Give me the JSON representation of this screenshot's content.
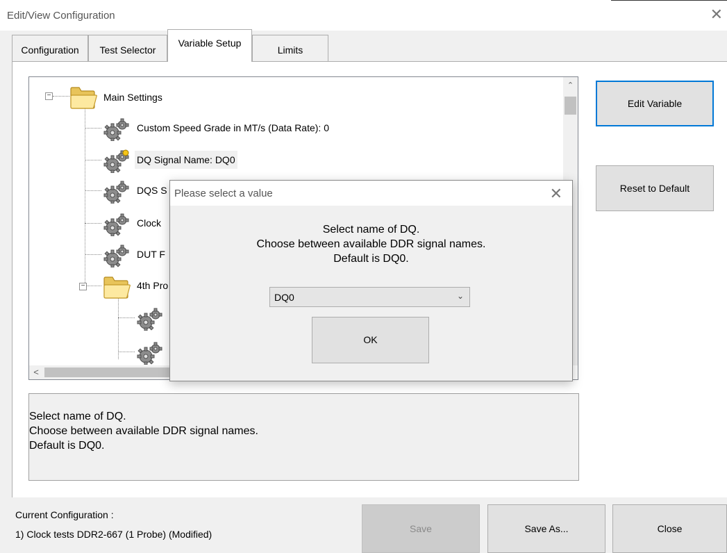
{
  "window": {
    "title": "Edit/View Configuration"
  },
  "tabs": [
    {
      "label": "Configuration"
    },
    {
      "label": "Test Selector"
    },
    {
      "label": "Variable Setup"
    },
    {
      "label": "Limits"
    }
  ],
  "tree": {
    "items": [
      {
        "label": "Main Settings"
      },
      {
        "label": "Custom Speed Grade in MT/s (Data Rate): 0"
      },
      {
        "label": "DQ Signal Name: DQ0"
      },
      {
        "label": "DQS S"
      },
      {
        "label": "Clock"
      },
      {
        "label": "DUT F"
      },
      {
        "label": "4th Pro"
      }
    ]
  },
  "buttons": {
    "edit_variable": "Edit Variable",
    "reset_default": "Reset to Default",
    "save": "Save",
    "save_as": "Save As...",
    "close": "Close"
  },
  "description": {
    "lines": [
      "Select name of DQ.",
      "Choose between available DDR signal names.",
      "Default is DQ0."
    ]
  },
  "status": {
    "label": "Current Configuration :",
    "value": "1) Clock tests DDR2-667 (1 Probe)  (Modified)"
  },
  "dialog": {
    "title": "Please select a value",
    "message": [
      "Select name of DQ.",
      "Choose between available DDR signal names.",
      "Default is DQ0."
    ],
    "selected_value": "DQ0",
    "ok_label": "OK"
  },
  "icons": {
    "folder": "folder-icon",
    "gear": "gears-icon",
    "gear_modified": "gears-modified-icon"
  }
}
